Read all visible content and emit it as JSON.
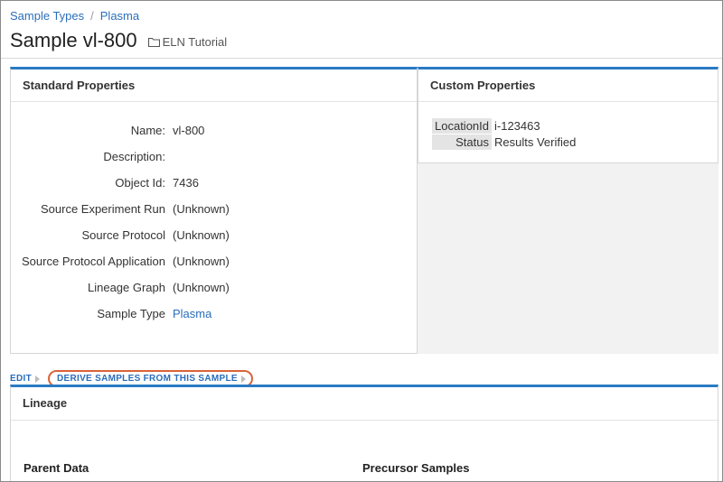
{
  "breadcrumb": {
    "items": [
      "Sample Types",
      "Plasma"
    ],
    "separator": "/"
  },
  "header": {
    "title": "Sample vl-800",
    "folder": "ELN Tutorial"
  },
  "standard_properties": {
    "title": "Standard Properties",
    "rows": [
      {
        "label": "Name:",
        "value": "vl-800"
      },
      {
        "label": "Description:",
        "value": ""
      },
      {
        "label": "Object Id:",
        "value": "7436"
      },
      {
        "label": "Source Experiment Run",
        "value": "(Unknown)"
      },
      {
        "label": "Source Protocol",
        "value": "(Unknown)"
      },
      {
        "label": "Source Protocol Application",
        "value": "(Unknown)"
      },
      {
        "label": "Lineage Graph",
        "value": "(Unknown)"
      },
      {
        "label": "Sample Type",
        "value": "Plasma"
      }
    ]
  },
  "custom_properties": {
    "title": "Custom Properties",
    "rows": [
      {
        "label": "LocationId",
        "value": "i-123463"
      },
      {
        "label": "Status",
        "value": "Results Verified"
      }
    ]
  },
  "actions": {
    "edit": "EDIT",
    "derive": "DERIVE SAMPLES FROM THIS SAMPLE"
  },
  "lineage": {
    "title": "Lineage",
    "parent_data": "Parent Data",
    "precursor_samples": "Precursor Samples"
  },
  "colors": {
    "accent": "#2a7bc4",
    "link": "#2a6ebb",
    "highlight": "#d9643a"
  }
}
